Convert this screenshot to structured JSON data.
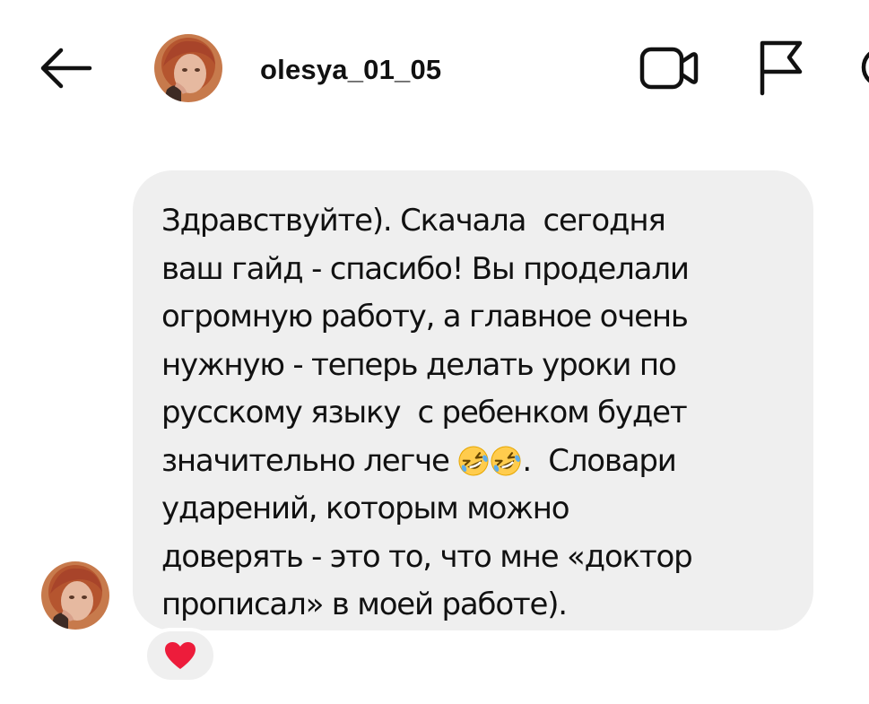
{
  "header": {
    "username": "olesya_01_05",
    "icons": {
      "back": "arrow-left-icon",
      "video": "video-camera-icon",
      "report": "flag-icon",
      "info": "info-icon"
    }
  },
  "message": {
    "lines": [
      "Здравствуйте). Скачала  сегодня",
      "ваш гайд - спасибо! Вы проделали",
      "огромную работу, а главное очень",
      "нужную - теперь делать уроки по",
      "русскому языку  с ребенком будет"
    ],
    "line6_before": "значительно легче ",
    "line6_after": ".  Словари",
    "lines_end": [
      "ударений, которым можно",
      "доверять - это то, что мне «доктор",
      "прописал» в моей работе)."
    ],
    "emoji": "rolling-on-floor-laughing-emoji",
    "emoji_count": 2
  },
  "reaction": {
    "emoji": "red-heart-icon",
    "color": "#ed1c3b"
  },
  "colors": {
    "bubble": "#efefef",
    "text": "#111111",
    "icon": "#111111"
  }
}
